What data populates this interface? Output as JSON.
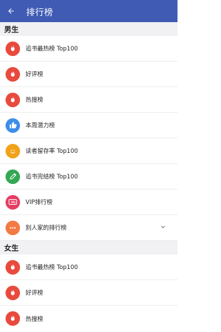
{
  "appbar": {
    "title": "排行榜"
  },
  "sections": [
    {
      "title": "男生",
      "items": [
        {
          "label": "追书最热榜 Top100",
          "icon": "flame-icon",
          "color": "#e84a3d"
        },
        {
          "label": "好评榜",
          "icon": "flame-icon",
          "color": "#e84a3d"
        },
        {
          "label": "热搜榜",
          "icon": "flame-icon",
          "color": "#e84a3d"
        },
        {
          "label": "本周潜力榜",
          "icon": "thumbs-up-icon",
          "color": "#3d8de9"
        },
        {
          "label": "读者留存率 Top100",
          "icon": "smile-icon",
          "color": "#f0a21b"
        },
        {
          "label": "追书完结榜 Top100",
          "icon": "pen-icon",
          "color": "#34a853"
        },
        {
          "label": "VIP排行榜",
          "icon": "vip-ticket-icon",
          "color": "#e63d63"
        },
        {
          "label": "别人家的排行榜",
          "icon": "more-dots-icon",
          "color": "#f27a43",
          "expandable": true
        }
      ]
    },
    {
      "title": "女生",
      "items": [
        {
          "label": "追书最热榜 Top100",
          "icon": "flame-icon",
          "color": "#e84a3d"
        },
        {
          "label": "好评榜",
          "icon": "flame-icon",
          "color": "#e84a3d"
        },
        {
          "label": "热搜榜",
          "icon": "flame-icon",
          "color": "#e84a3d"
        }
      ]
    }
  ]
}
